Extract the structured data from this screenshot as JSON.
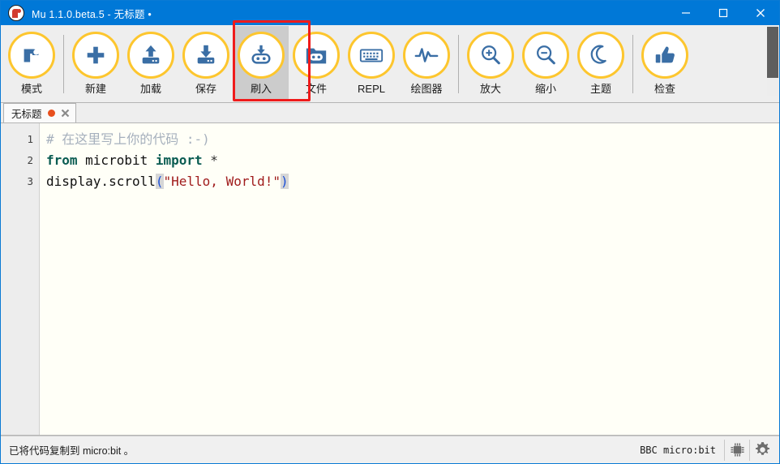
{
  "window": {
    "title": "Mu 1.1.0.beta.5 - 无标题 •",
    "logo_icon": "mu-logo-icon",
    "minimize_label": "—",
    "maximize_label": "□",
    "close_label": "✕",
    "accent_color": "#0078d7"
  },
  "toolbar": {
    "highlight_color": "#ef1b1b",
    "circle_color": "#fdc62e",
    "icon_color": "#3a6ea5",
    "buttons": [
      {
        "id": "mode",
        "label": "模式",
        "icon": "mu-mode-icon",
        "active": false
      },
      {
        "id": "new",
        "label": "新建",
        "icon": "plus-icon",
        "active": false
      },
      {
        "id": "load",
        "label": "加载",
        "icon": "upload-arrow-icon",
        "active": false
      },
      {
        "id": "save",
        "label": "保存",
        "icon": "download-save-icon",
        "active": false
      },
      {
        "id": "flash",
        "label": "刷入",
        "icon": "robot-flash-icon",
        "active": true
      },
      {
        "id": "files",
        "label": "文件",
        "icon": "folder-robot-icon",
        "active": false
      },
      {
        "id": "repl",
        "label": "REPL",
        "icon": "keyboard-icon",
        "active": false
      },
      {
        "id": "plotter",
        "label": "绘图器",
        "icon": "waveform-icon",
        "active": false
      },
      {
        "id": "zoomin",
        "label": "放大",
        "icon": "zoom-in-icon",
        "active": false
      },
      {
        "id": "zoomout",
        "label": "缩小",
        "icon": "zoom-out-icon",
        "active": false
      },
      {
        "id": "theme",
        "label": "主题",
        "icon": "moon-icon",
        "active": false
      },
      {
        "id": "check",
        "label": "检查",
        "icon": "thumbs-up-icon",
        "active": false
      }
    ]
  },
  "tabs": [
    {
      "label": "无标题",
      "modified": true,
      "modified_color": "#e8501e",
      "close_icon": "close-icon"
    }
  ],
  "editor": {
    "line_numbers": [
      "1",
      "2",
      "3"
    ],
    "lines": [
      [
        {
          "t": "# 在这里写上你的代码 :-)",
          "c": "cm"
        }
      ],
      [
        {
          "t": "from",
          "c": "kw"
        },
        {
          "t": " microbit ",
          "c": ""
        },
        {
          "t": "import",
          "c": "kw"
        },
        {
          "t": " ",
          "c": ""
        },
        {
          "t": "*",
          "c": "op"
        }
      ],
      [
        {
          "t": "display.scroll",
          "c": ""
        },
        {
          "t": "(",
          "c": "brk"
        },
        {
          "t": "\"Hello, World!\"",
          "c": "str"
        },
        {
          "t": ")",
          "c": "brk"
        }
      ]
    ],
    "background_color": "#fffff7",
    "comment_color": "#a6b0bd",
    "keyword_color": "#0a5c52",
    "string_color": "#a01c1c"
  },
  "statusbar": {
    "message": "已将代码复制到 micro:bit 。",
    "device": "BBC micro:bit",
    "chip_icon": "microchip-icon",
    "settings_icon": "gear-icon"
  }
}
